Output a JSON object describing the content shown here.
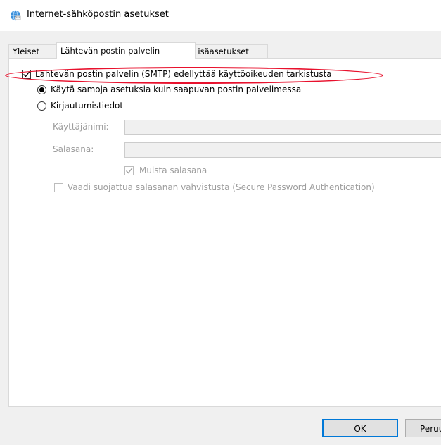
{
  "window": {
    "title": "Internet-sähköpostin asetukset",
    "icon": "globe-mail-icon"
  },
  "tabs": [
    {
      "label": "Yleiset",
      "active": false
    },
    {
      "label": "Lähtevän postin palvelin",
      "active": true
    },
    {
      "label": "Lisäasetukset",
      "active": false
    }
  ],
  "outgoing": {
    "smtp_auth_label": "Lähtevän postin palvelin (SMTP) edellyttää käyttöoikeuden tarkistusta",
    "smtp_auth_checked": true,
    "use_same_label": "Käytä samoja asetuksia kuin saapuvan postin palvelimessa",
    "use_same_selected": true,
    "login_label": "Kirjautumistiedot",
    "login_selected": false,
    "username_label": "Käyttäjänimi:",
    "username_value": "",
    "password_label": "Salasana:",
    "password_value": "",
    "remember_label": "Muista salasana",
    "remember_checked": true,
    "spa_label": "Vaadi suojattua salasanan vahvistusta (Secure Password Authentication)",
    "spa_checked": false
  },
  "buttons": {
    "ok": "OK",
    "cancel": "Peruuta"
  },
  "colors": {
    "highlight": "#e8112d",
    "accent": "#0078d7"
  }
}
